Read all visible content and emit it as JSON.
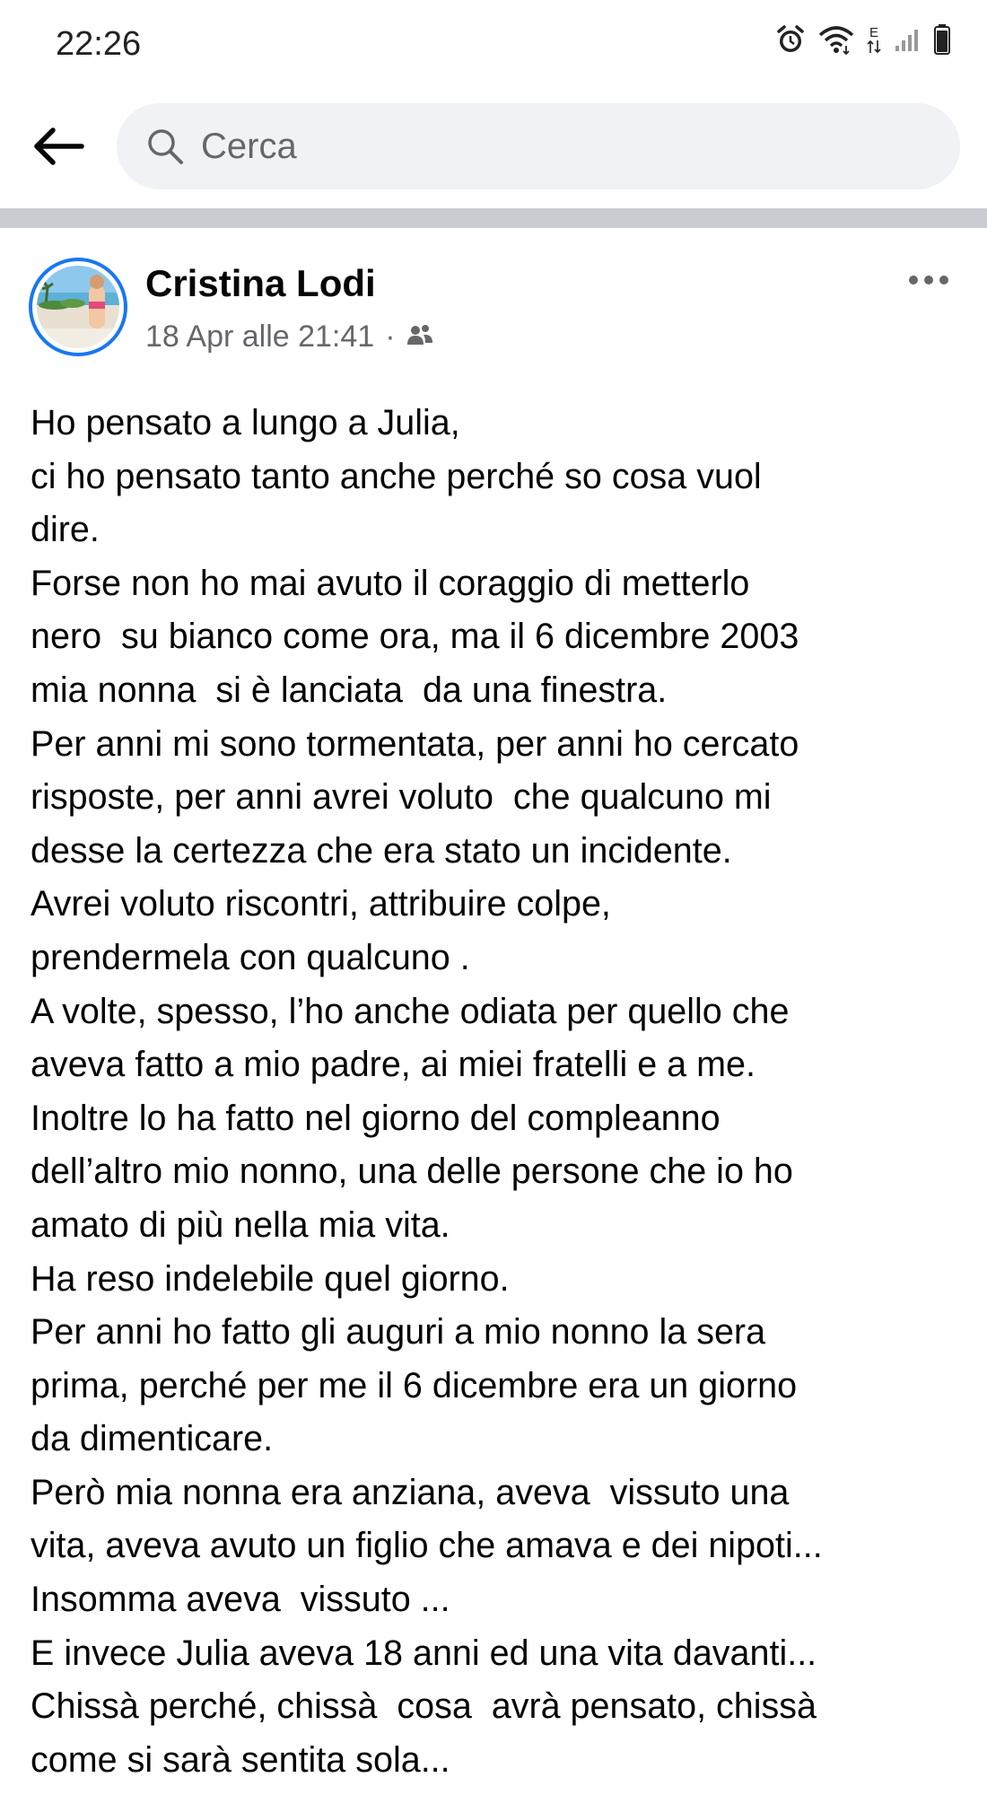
{
  "status_bar": {
    "time": "22:26",
    "icons": [
      "alarm-icon",
      "wifi-icon",
      "data-arrows-icon",
      "signal-icon",
      "battery-icon"
    ],
    "data_indicator": "E"
  },
  "search": {
    "back_icon": "arrow-left-icon",
    "placeholder": "Cerca"
  },
  "post": {
    "author": "Cristina Lodi",
    "timestamp": "18 Apr alle 21:41",
    "separator": "·",
    "audience_icon": "friends-icon",
    "more_icon": "more-horizontal-icon",
    "lines": [
      "Ho pensato a lungo a Julia,",
      "ci ho pensato tanto anche perché so cosa vuol",
      "dire.",
      "Forse non ho mai avuto il coraggio di metterlo",
      "nero  su bianco come ora, ma il 6 dicembre 2003",
      "mia nonna  si è lanciata  da una finestra.",
      "Per anni mi sono tormentata, per anni ho cercato",
      "risposte, per anni avrei voluto  che qualcuno mi",
      "desse la certezza che era stato un incidente.",
      "Avrei voluto riscontri, attribuire colpe,",
      "prendermela con qualcuno .",
      "A volte, spesso, l’ho anche odiata per quello che",
      "aveva fatto a mio padre, ai miei fratelli e a me.",
      "Inoltre lo ha fatto nel giorno del compleanno",
      "dell’altro mio nonno, una delle persone che io ho",
      "amato di più nella mia vita.",
      "Ha reso indelebile quel giorno.",
      "Per anni ho fatto gli auguri a mio nonno la sera",
      "prima, perché per me il 6 dicembre era un giorno",
      "da dimenticare.",
      "Però mia nonna era anziana, aveva  vissuto una",
      "vita, aveva avuto un figlio che amava e dei nipoti...",
      "Insomma aveva  vissuto ...",
      "E invece Julia aveva 18 anni ed una vita davanti...",
      "Chissà perché, chissà  cosa  avrà pensato, chissà",
      "come si sarà sentita sola..."
    ]
  },
  "colors": {
    "accent": "#1877f2",
    "search_bg": "#f0f2f5",
    "divider": "#c9ccd1",
    "secondary_text": "#65676b"
  }
}
